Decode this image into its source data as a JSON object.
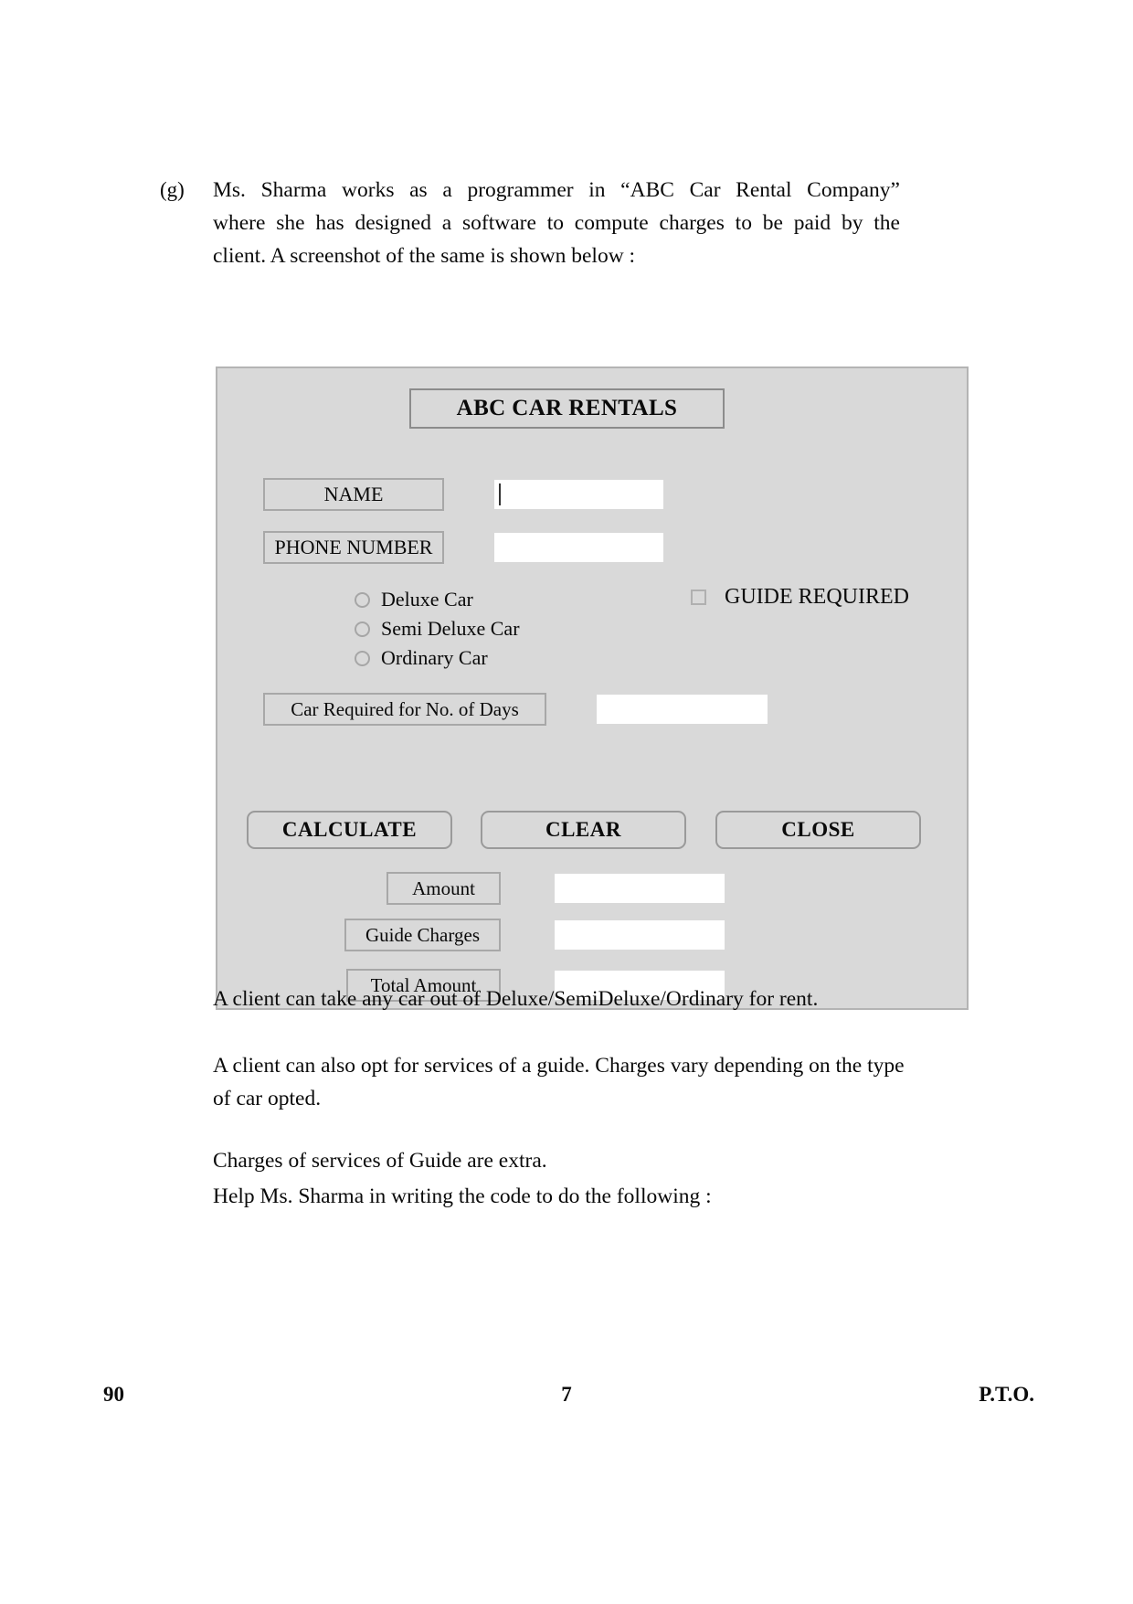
{
  "question": {
    "marker": "(g)",
    "lines": [
      "Ms. Sharma works as a programmer in “ABC Car Rental Company”",
      "where she has designed a software to compute charges to be paid by the",
      "client.  A screenshot of the same is shown below :"
    ]
  },
  "form": {
    "title": "ABC CAR RENTALS",
    "fields": {
      "name_label": "NAME",
      "name_value": "",
      "phone_label": "PHONE NUMBER",
      "phone_value": "",
      "days_label": "Car Required for No. of Days",
      "days_value": ""
    },
    "car_options": [
      {
        "label": "Deluxe Car",
        "selected": false
      },
      {
        "label": "Semi Deluxe Car",
        "selected": false
      },
      {
        "label": "Ordinary Car",
        "selected": false
      }
    ],
    "guide": {
      "label": "GUIDE REQUIRED",
      "checked": false
    },
    "buttons": [
      {
        "label": "CALCULATE"
      },
      {
        "label": "CLEAR"
      },
      {
        "label": "CLOSE"
      }
    ],
    "outputs": [
      {
        "label": "Amount",
        "value": ""
      },
      {
        "label": "Guide Charges",
        "value": ""
      },
      {
        "label": "Total Amount",
        "value": ""
      }
    ],
    "colors": {
      "panel_background": "#d9d9d9",
      "field_background": "#ffffff",
      "border": "#a8a8a8",
      "title_border": "#8c8c8c"
    }
  },
  "notes": {
    "p1": "A client can take any car out of Deluxe/SemiDeluxe/Ordinary for rent.",
    "p2_line1": "A client can also opt for services of a guide.  Charges vary depending on",
    "p2_line2": "the type of car opted.",
    "p3": "Charges of services of Guide are extra.",
    "p4": "Help Ms. Sharma in writing the code to do the following :"
  },
  "footer": {
    "left": "90",
    "center": "7",
    "right": "P.T.O."
  }
}
